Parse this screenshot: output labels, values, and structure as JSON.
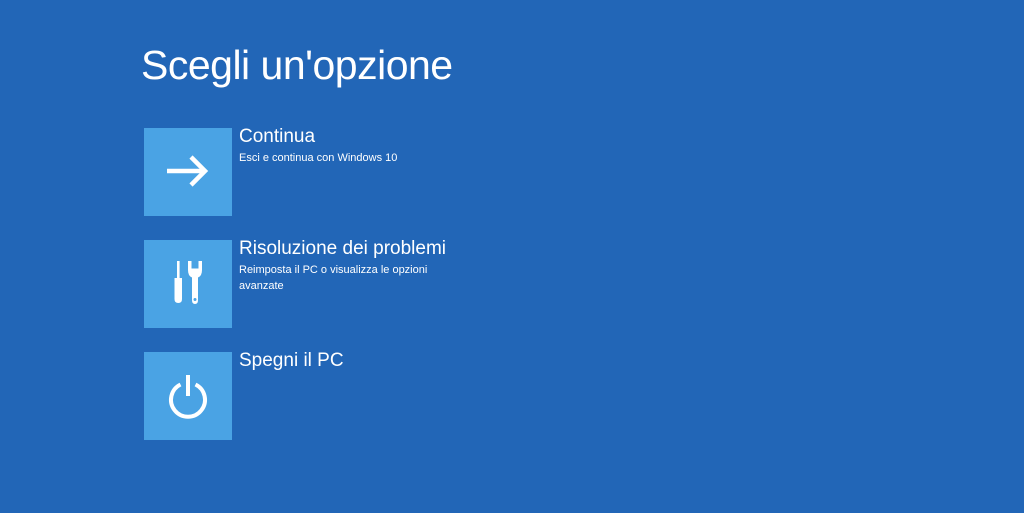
{
  "colors": {
    "background": "#2266b7",
    "tile": "#4aa3e4",
    "text": "#ffffff"
  },
  "page": {
    "title": "Scegli un'opzione"
  },
  "options": [
    {
      "label": "Continua",
      "description": "Esci e continua con Windows 10",
      "icon": "arrow-right-icon"
    },
    {
      "label": "Risoluzione dei problemi",
      "description": "Reimposta il PC o visualizza le opzioni avanzate",
      "icon": "tools-icon"
    },
    {
      "label": "Spegni il PC",
      "description": "",
      "icon": "power-icon"
    }
  ]
}
